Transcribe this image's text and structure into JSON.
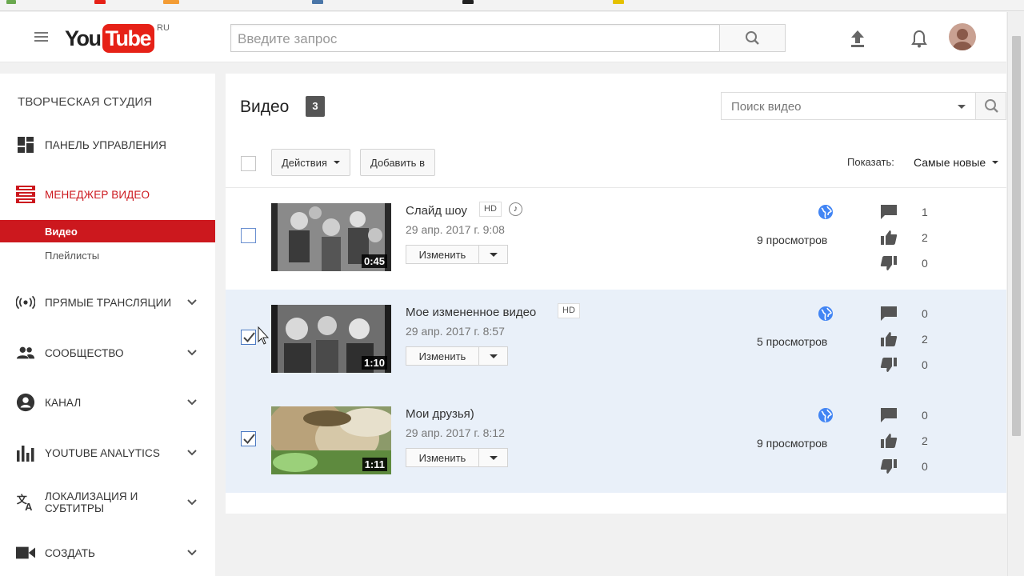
{
  "header": {
    "logo_you": "You",
    "logo_tube": "Tube",
    "logo_region": "RU",
    "search_placeholder": "Введите запрос"
  },
  "sidebar": {
    "title": "ТВОРЧЕСКАЯ СТУДИЯ",
    "items": [
      {
        "label": "ПАНЕЛЬ УПРАВЛЕНИЯ",
        "icon": "dashboard-icon"
      },
      {
        "label": "МЕНЕДЖЕР ВИДЕО",
        "icon": "video-manager-icon"
      },
      {
        "label": "ПРЯМЫЕ ТРАНСЛЯЦИИ",
        "icon": "live-icon"
      },
      {
        "label": "СООБЩЕСТВО",
        "icon": "community-icon"
      },
      {
        "label": "КАНАЛ",
        "icon": "channel-icon"
      },
      {
        "label": "YOUTUBE ANALYTICS",
        "icon": "analytics-icon"
      },
      {
        "label": "ЛОКАЛИЗАЦИЯ И СУБТИТРЫ",
        "icon": "translate-icon"
      },
      {
        "label": "СОЗДАТЬ",
        "icon": "create-icon"
      }
    ],
    "subitems": [
      {
        "label": "Видео"
      },
      {
        "label": "Плейлисты"
      }
    ]
  },
  "main": {
    "title": "Видео",
    "count": "3",
    "search_placeholder": "Поиск видео",
    "actions_label": "Действия",
    "add_to_label": "Добавить в",
    "show_label": "Показать:",
    "sort_value": "Самые новые",
    "edit_label": "Изменить",
    "videos": [
      {
        "title": "Слайд шоу",
        "hd": "HD",
        "date": "29 апр. 2017 г. 9:08",
        "duration": "0:45",
        "views": "9 просмотров",
        "comments": "1",
        "likes": "2",
        "dislikes": "0",
        "checked": false
      },
      {
        "title": "Мое измененное видео",
        "hd": "HD",
        "date": "29 апр. 2017 г. 8:57",
        "duration": "1:10",
        "views": "5 просмотров",
        "comments": "0",
        "likes": "2",
        "dislikes": "0",
        "checked": true
      },
      {
        "title": "Мои друзья)",
        "hd": "",
        "date": "29 апр. 2017 г. 8:12",
        "duration": "1:11",
        "views": "9 просмотров",
        "comments": "0",
        "likes": "2",
        "dislikes": "0",
        "checked": true
      }
    ]
  },
  "colors": {
    "brand_red": "#e62117",
    "studio_red": "#cc181e",
    "selected_row": "#e9f0f9",
    "globe_blue": "#4285f4"
  }
}
